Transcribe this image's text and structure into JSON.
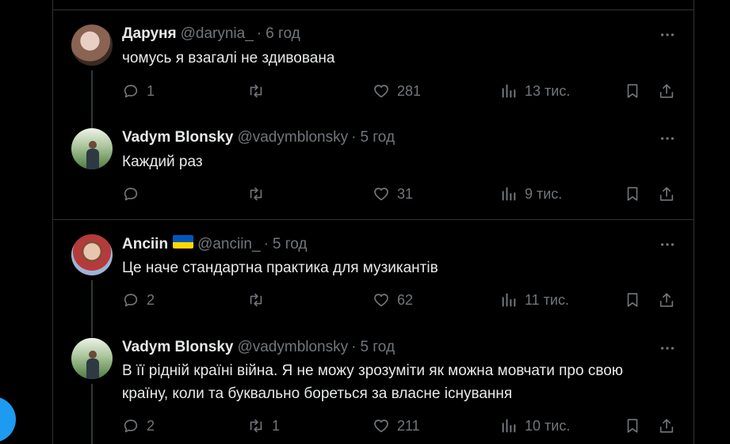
{
  "tweets": [
    {
      "name": "Даруня",
      "handle": "@darynia_",
      "dot": "·",
      "time": "6 год",
      "text": "чомусь я взагалі не здивована",
      "replies": "1",
      "retweets": "",
      "likes": "281",
      "views": "13 тис.",
      "avatar_colors": [
        "#c9a79a",
        "#6b4a3a"
      ]
    },
    {
      "name": "Vadym Blonsky",
      "handle": "@vadymblonsky",
      "dot": "·",
      "time": "5 год",
      "text": "Каждий раз",
      "replies": "",
      "retweets": "",
      "likes": "31",
      "views": "9 тис.",
      "avatar_colors": [
        "#d8e4cf",
        "#4f7a3d"
      ]
    },
    {
      "name": "Anciin",
      "handle": "@anciin_",
      "dot": "·",
      "time": "5 год",
      "text": "Це наче стандартна практика для музикантів",
      "replies": "2",
      "retweets": "",
      "likes": "62",
      "views": "11 тис.",
      "avatar_colors": [
        "#b53b3b",
        "#e3c3ae"
      ]
    },
    {
      "name": "Vadym Blonsky",
      "handle": "@vadymblonsky",
      "dot": "·",
      "time": "5 год",
      "text": "В її рідній країні війна. Я не можу зрозуміти як можна мовчати про свою країну, коли та буквально бореться за власне існування",
      "replies": "2",
      "retweets": "1",
      "likes": "211",
      "views": "10 тис.",
      "avatar_colors": [
        "#d8e4cf",
        "#4f7a3d"
      ]
    }
  ],
  "colors": {
    "background": "#000000",
    "text": "#e7e9ea",
    "muted": "#71767b",
    "border": "#2f3336",
    "accent": "#1d9bf0"
  },
  "icons": [
    "reply-icon",
    "retweet-icon",
    "like-icon",
    "views-icon",
    "bookmark-icon",
    "share-icon",
    "more-icon",
    "ukraine-flag-icon"
  ]
}
